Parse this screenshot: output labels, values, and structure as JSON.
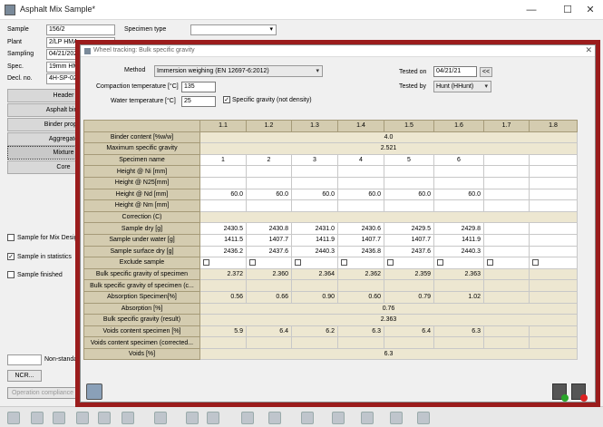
{
  "background": {
    "title": "Asphalt Mix Sample*",
    "controls": {
      "minimize": "—",
      "maximize": "☐",
      "close": "✕"
    },
    "labels": {
      "sample": "Sample",
      "plant": "Plant",
      "sampling": "Sampling",
      "spec": "Spec.",
      "decl": "Decl. no.",
      "specimen_type": "Specimen type"
    },
    "values": {
      "sample": "156/2",
      "plant": "2/LP HMA",
      "sampling": "04/21/202",
      "spec": "19mm HMA",
      "decl": "4H-SP-021"
    },
    "tabs": [
      "Header",
      "Asphalt bind",
      "Binder proper",
      "Aggregate",
      "Mixture",
      "Core"
    ],
    "active_tab": "Mixture",
    "checks": [
      {
        "label": "Sample for Mix Design",
        "checked": ""
      },
      {
        "label": "Sample in statistics",
        "checked": "✓"
      },
      {
        "label": "Sample finished",
        "checked": ""
      }
    ],
    "non_standard": "Non-standar",
    "ncr_button": "NCR...",
    "op_button": "Operation compliance"
  },
  "dialog": {
    "title": "Wheel tracking: Bulk specific gravity",
    "close": "✕",
    "method_label": "Method",
    "method_value": "Immersion weighing (EN 12697-6:2012)",
    "compaction_label": "Compaction temperature [°C]",
    "compaction_value": "135",
    "water_label": "Water temperature [°C]",
    "water_value": "25",
    "sg_check_label": "Specific gravity (not density)",
    "sg_check_mark": "✓",
    "tested_on_label": "Tested on",
    "tested_on_value": "04/21/21",
    "tested_on_btn": "<<",
    "tested_by_label": "Tested by",
    "tested_by_value": "Hunt (HHunt)",
    "columns": [
      "1.1",
      "1.2",
      "1.3",
      "1.4",
      "1.5",
      "1.6",
      "1.7",
      "1.8"
    ],
    "rows": {
      "binder_content": {
        "label": "Binder content [%w/w]",
        "span": "4.0"
      },
      "max_sg": {
        "label": "Maximum specific gravity",
        "span": "2.521"
      },
      "specimen_name": {
        "label": "Specimen name",
        "v": [
          "1",
          "2",
          "3",
          "4",
          "5",
          "6",
          "",
          ""
        ]
      },
      "h_ni": {
        "label": "Height @ Ni [mm]"
      },
      "h_n25": {
        "label": "Height @ N25[mm]"
      },
      "h_nd": {
        "label": "Height @ Nd [mm]",
        "v": [
          "60.0",
          "60.0",
          "60.0",
          "60.0",
          "60.0",
          "60.0",
          "",
          ""
        ]
      },
      "h_nm": {
        "label": "Height @ Nm [mm]"
      },
      "correction": {
        "label": "Correction (C)"
      },
      "dry": {
        "label": "Sample dry [g]",
        "v": [
          "2430.5",
          "2430.8",
          "2431.0",
          "2430.6",
          "2429.5",
          "2429.8",
          "",
          ""
        ]
      },
      "under_water": {
        "label": "Sample under water [g]",
        "v": [
          "1411.5",
          "1407.7",
          "1411.9",
          "1407.7",
          "1407.7",
          "1411.9",
          "",
          ""
        ]
      },
      "surface_dry": {
        "label": "Sample surface dry [g]",
        "v": [
          "2436.2",
          "2437.6",
          "2440.3",
          "2436.8",
          "2437.6",
          "2440.3",
          "",
          ""
        ]
      },
      "exclude": {
        "label": "Exclude sample"
      },
      "bsg_specimen": {
        "label": "Bulk specific gravity of specimen",
        "v": [
          "2.372",
          "2.360",
          "2.364",
          "2.362",
          "2.359",
          "2.363",
          "",
          ""
        ]
      },
      "bsg_specimen_c": {
        "label": "Bulk specific gravity of specimen (c..."
      },
      "abs_specimen": {
        "label": "Absorption Specimen[%]",
        "v": [
          "0.56",
          "0.66",
          "0.90",
          "0.60",
          "0.79",
          "1.02",
          "",
          ""
        ]
      },
      "absorption": {
        "label": "Absorption [%]",
        "span": "0.76"
      },
      "bsg_result": {
        "label": "Bulk specific gravity (result)",
        "span": "2.363"
      },
      "voids_specimen": {
        "label": "Voids content specimen [%]",
        "v": [
          "5.9",
          "6.4",
          "6.2",
          "6.3",
          "6.4",
          "6.3",
          "",
          ""
        ]
      },
      "voids_specimen_c": {
        "label": "Voids content specimen (corrected..."
      },
      "voids": {
        "label": "Voids [%]",
        "span": "6.3"
      }
    }
  }
}
